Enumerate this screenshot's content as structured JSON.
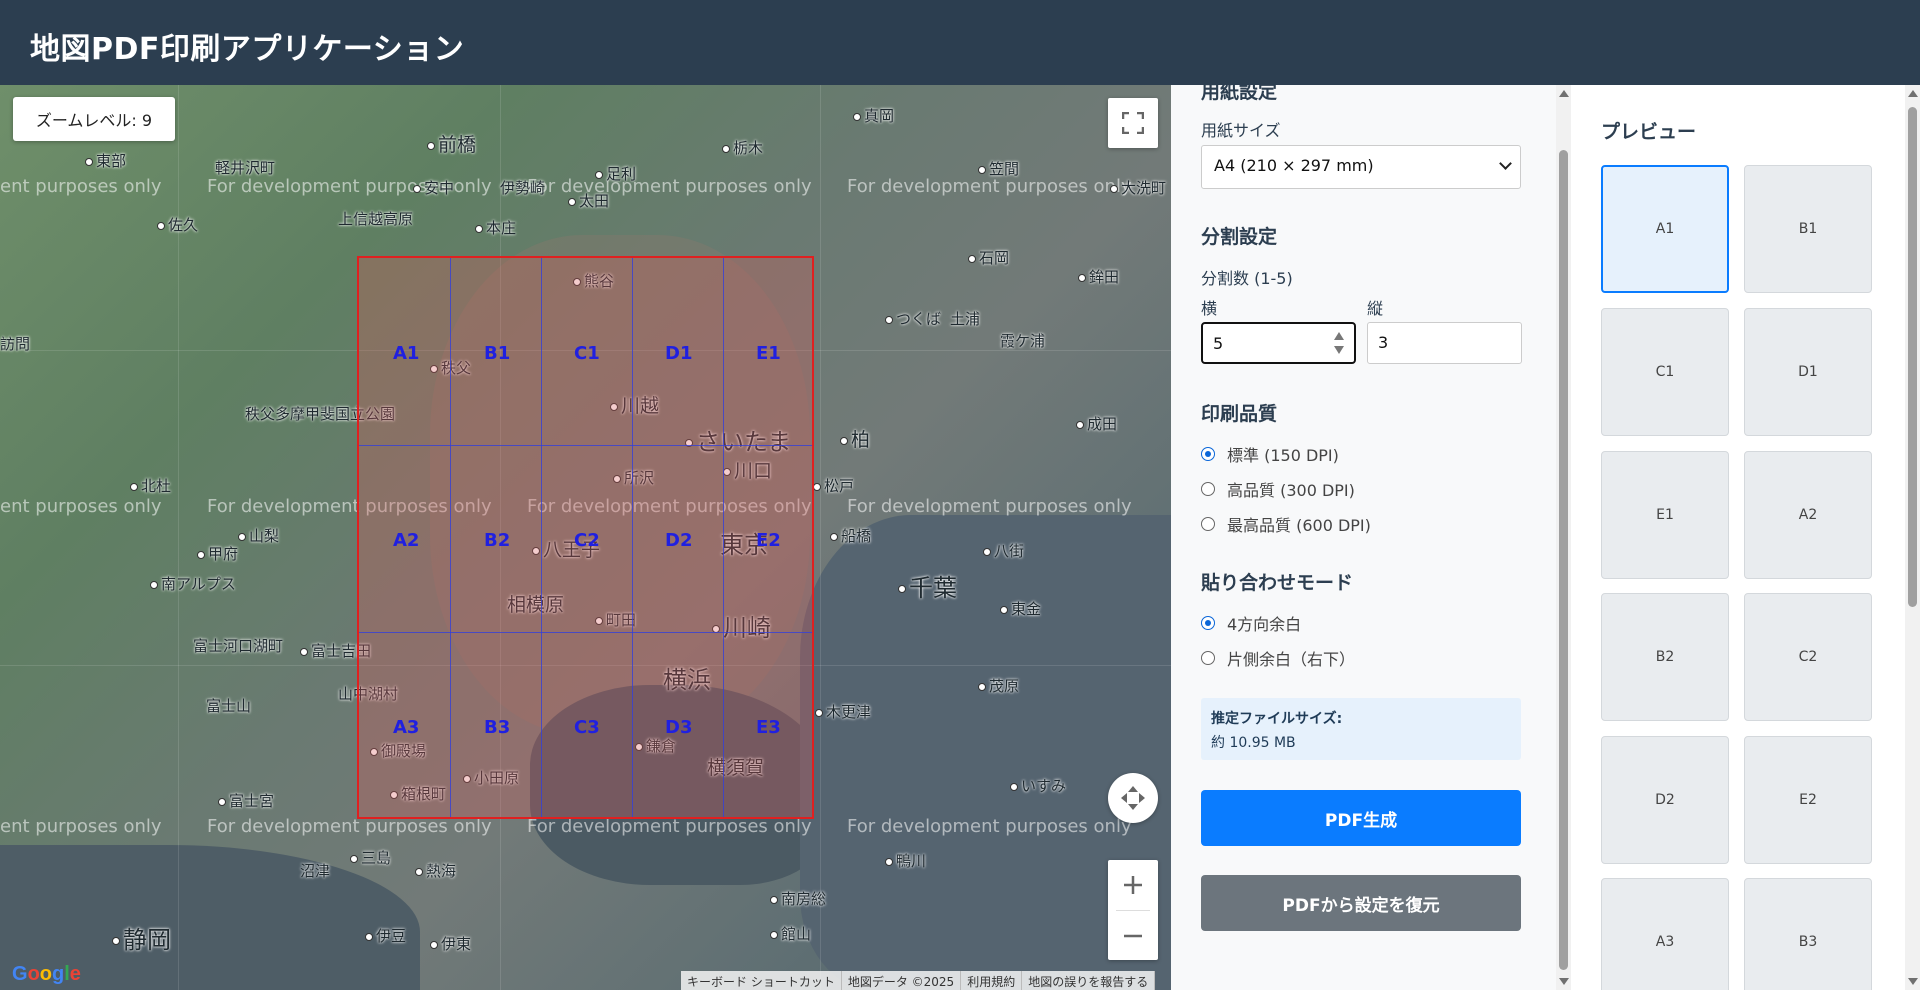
{
  "header": {
    "title": "地図PDF印刷アプリケーション"
  },
  "map": {
    "zoom_label": "ズームレベル: 9",
    "watermark": "For development purposes only",
    "watermark_left": "ent purposes only",
    "places": [
      "前橋",
      "東部",
      "軽井沢町",
      "足利",
      "栃木",
      "真岡",
      "笠間",
      "安中",
      "伊勢崎",
      "太田",
      "大洗町",
      "佐久",
      "上信越高原",
      "本庄",
      "石岡",
      "鉾田",
      "熊谷",
      "つくば",
      "土浦",
      "霞ケ浦",
      "訪問",
      "秩父",
      "川越",
      "さいたま",
      "柏",
      "成田",
      "秩父多摩甲斐国立公園",
      "北杜",
      "所沢",
      "川口",
      "松戸",
      "千葉",
      "甲府",
      "八王子",
      "東京",
      "船橋",
      "八街",
      "山梨",
      "南アルプス",
      "相模原",
      "町田",
      "川崎",
      "東金",
      "富士河口湖町",
      "富士吉田",
      "横浜",
      "木更津",
      "茂原",
      "山中湖村",
      "富士山",
      "御殿場",
      "小田原",
      "鎌倉",
      "横須賀",
      "富士宮",
      "箱根町",
      "いすみ",
      "三島",
      "熱海",
      "鴨川",
      "沼津",
      "南房総",
      "静岡",
      "伊豆",
      "伊東",
      "館山"
    ],
    "grid_labels": [
      "A1",
      "B1",
      "C1",
      "D1",
      "E1",
      "A2",
      "B2",
      "C2",
      "D2",
      "E2",
      "A3",
      "B3",
      "C3",
      "D3",
      "E3"
    ],
    "google_logo": "Google",
    "attribution": [
      "キーボード ショートカット",
      "地図データ ©2025",
      "利用規約",
      "地図の誤りを報告する"
    ]
  },
  "settings": {
    "section_paper_partial": "用紙設定",
    "paper_size_label": "用紙サイズ",
    "paper_size_value": "A4 (210 × 297 mm)",
    "split_heading": "分割設定",
    "split_count_label": "分割数 (1-5)",
    "horizontal_label": "横",
    "vertical_label": "縦",
    "horizontal_value": "5",
    "vertical_value": "3",
    "quality_heading": "印刷品質",
    "quality_options": [
      "標準 (150 DPI)",
      "高品質 (300 DPI)",
      "最高品質 (600 DPI)"
    ],
    "quality_selected": 0,
    "paste_heading": "貼り合わせモード",
    "paste_options": [
      "4方向余白",
      "片側余白（右下）"
    ],
    "paste_selected": 0,
    "filesize_title": "推定ファイルサイズ:",
    "filesize_value": "約 10.95 MB",
    "generate_button": "PDF生成",
    "restore_button": "PDFから設定を復元"
  },
  "preview": {
    "title": "プレビュー",
    "pages": [
      "A1",
      "B1",
      "C1",
      "D1",
      "E1",
      "A2",
      "B2",
      "C2",
      "D2",
      "E2",
      "A3",
      "B3"
    ],
    "selected_index": 0
  },
  "colors": {
    "header_bg": "#2c3e50",
    "primary": "#0a7cff",
    "secondary": "#6c757d",
    "print_border": "#e02020",
    "grid_label": "#2020e0"
  }
}
